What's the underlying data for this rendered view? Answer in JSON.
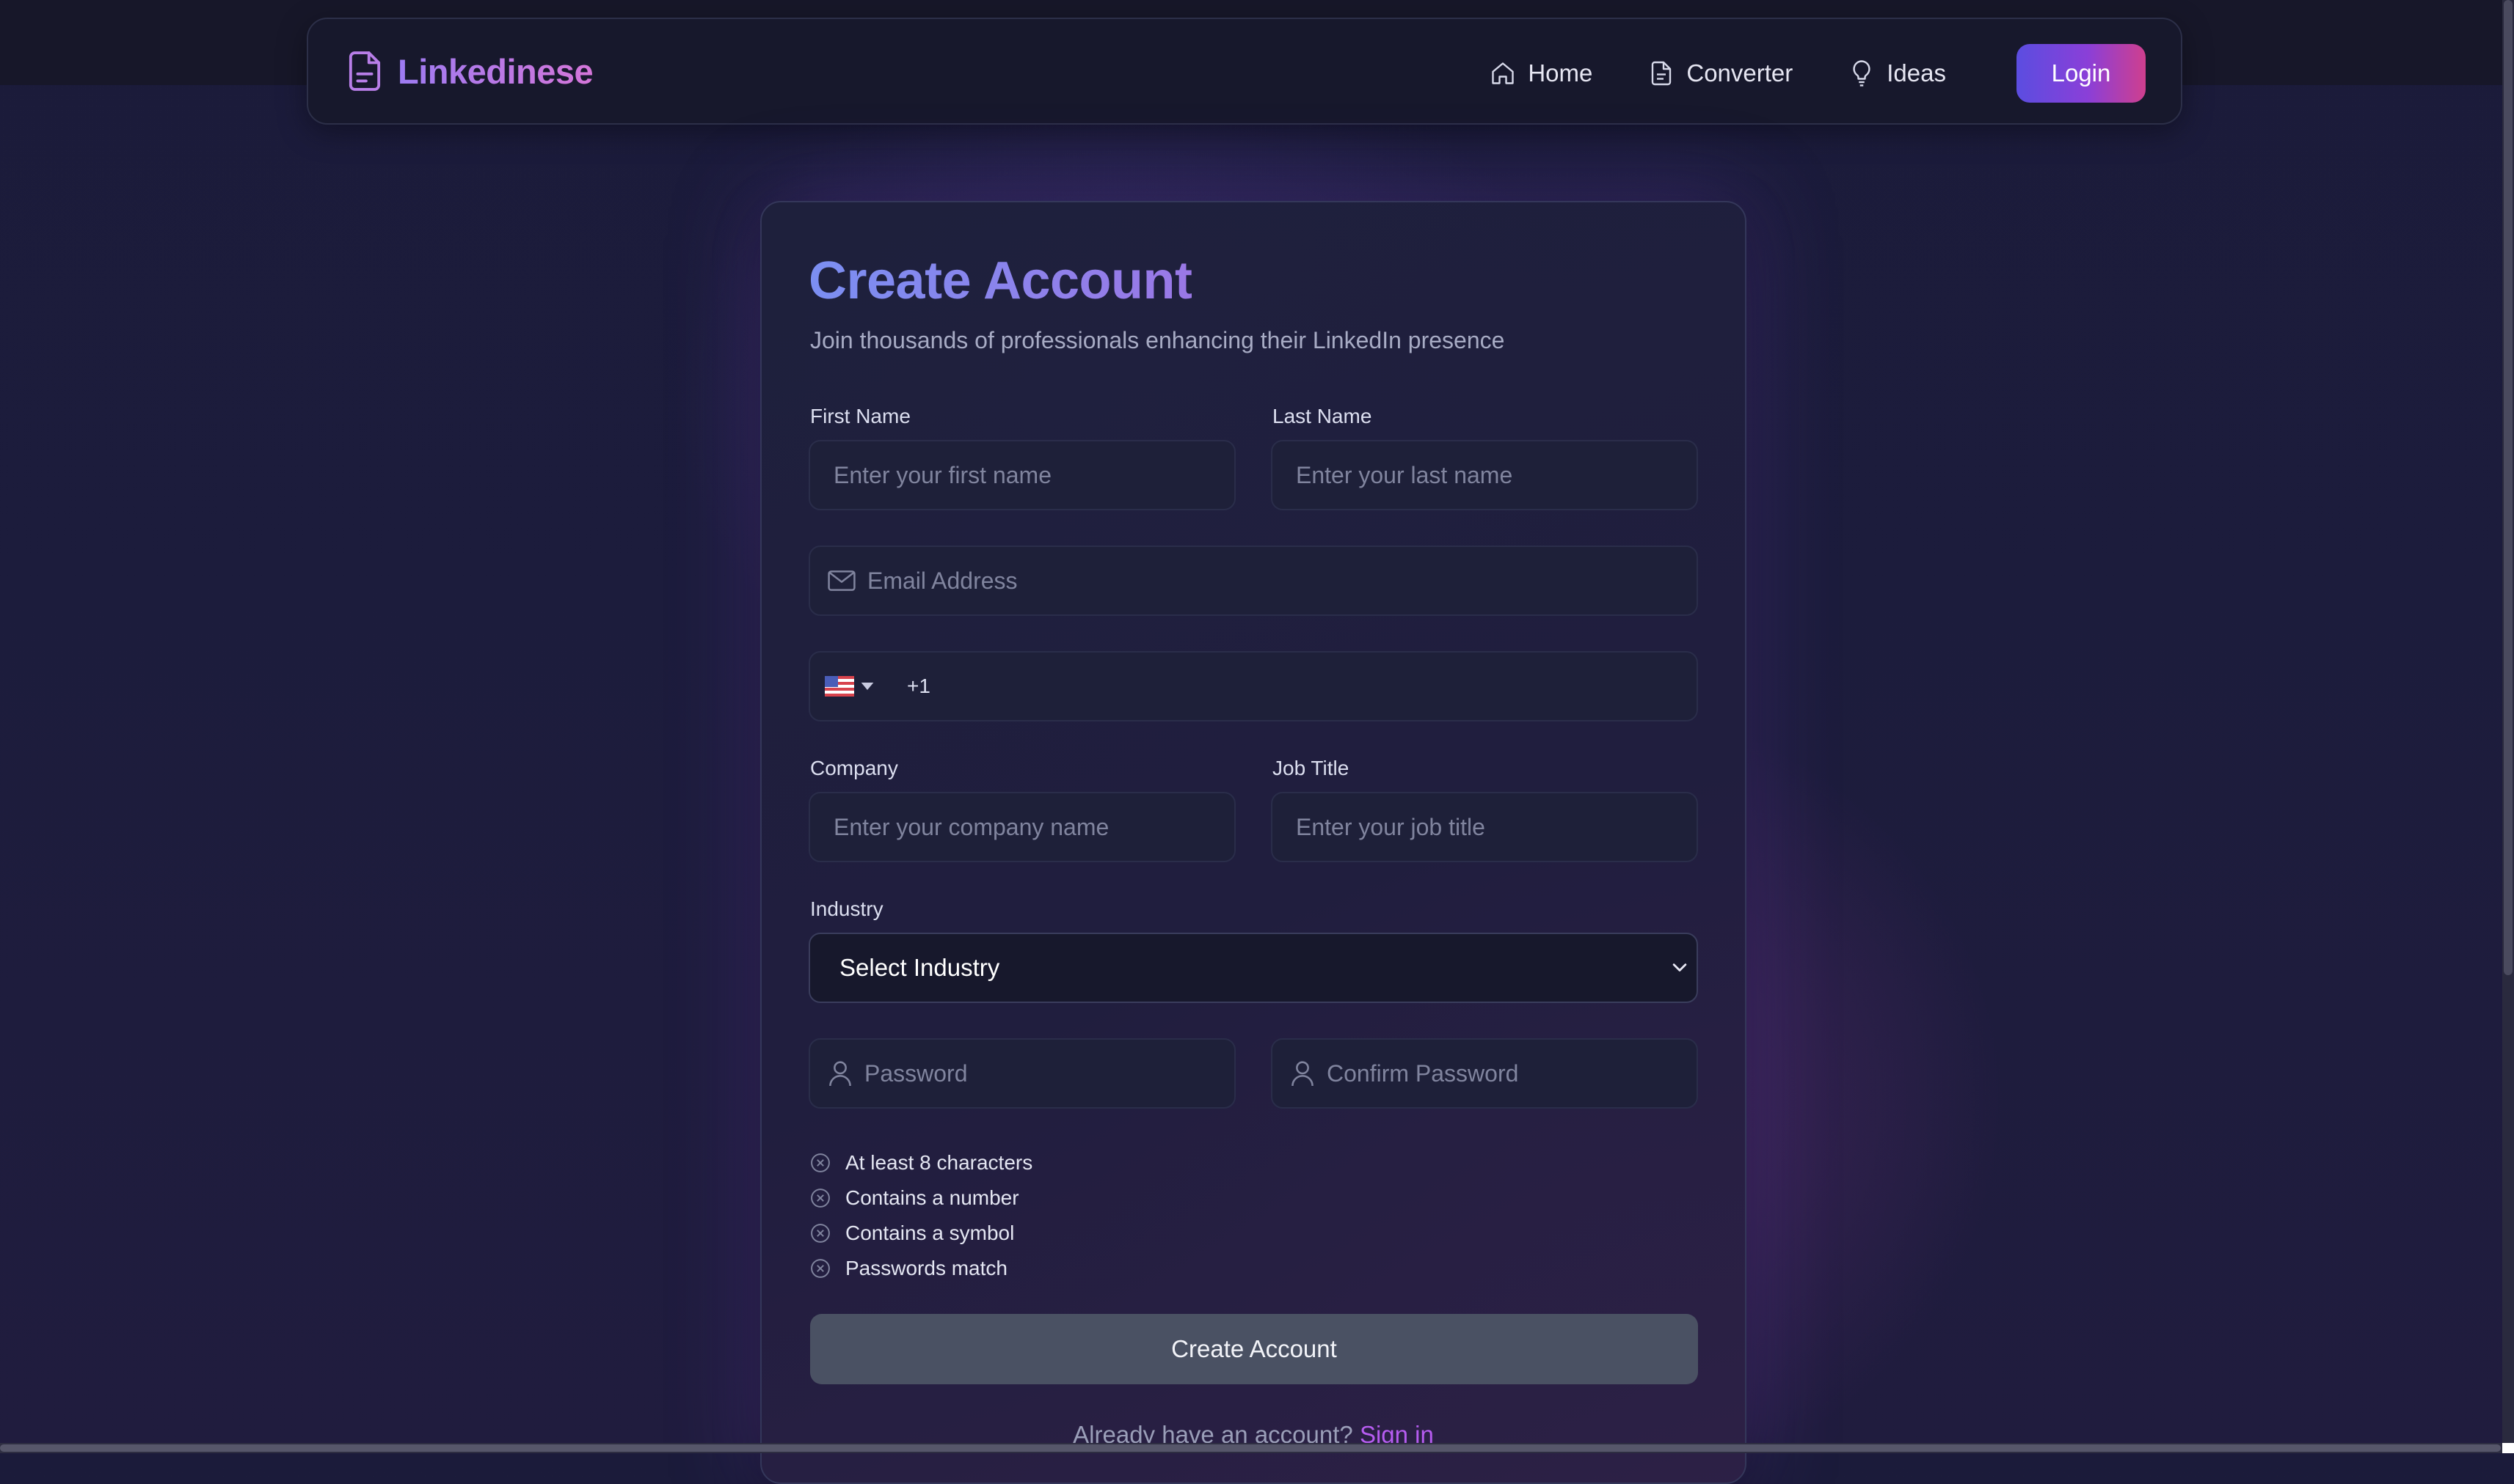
{
  "app": {
    "brand": "Linkedinese"
  },
  "nav": {
    "items": [
      {
        "label": "Home",
        "icon": "home-icon"
      },
      {
        "label": "Converter",
        "icon": "document-icon"
      },
      {
        "label": "Ideas",
        "icon": "lightbulb-icon"
      }
    ],
    "login_label": "Login"
  },
  "form": {
    "title": "Create Account",
    "subtitle": "Join thousands of professionals enhancing their LinkedIn presence",
    "first_name": {
      "label": "First Name",
      "placeholder": "Enter your first name",
      "value": ""
    },
    "last_name": {
      "label": "Last Name",
      "placeholder": "Enter your last name",
      "value": ""
    },
    "email": {
      "placeholder": "Email Address",
      "value": ""
    },
    "phone": {
      "country": "US",
      "dial_code": "+1",
      "value": ""
    },
    "company": {
      "label": "Company",
      "placeholder": "Enter your company name",
      "value": ""
    },
    "job_title": {
      "label": "Job Title",
      "placeholder": "Enter your job title",
      "value": ""
    },
    "industry": {
      "label": "Industry",
      "selected": "Select Industry"
    },
    "password": {
      "placeholder": "Password",
      "value": ""
    },
    "confirm_password": {
      "placeholder": "Confirm Password",
      "value": ""
    },
    "requirements": [
      "At least 8 characters",
      "Contains a number",
      "Contains a symbol",
      "Passwords match"
    ],
    "submit_label": "Create Account",
    "signin_prompt": "Already have an account?",
    "signin_link": "Sign in"
  },
  "colors": {
    "brand_gradient_start": "#9d7bf2",
    "brand_gradient_end": "#d576d9",
    "login_gradient_start": "#5b4de0",
    "login_gradient_end": "#cf3f8e",
    "link": "#b65cf0",
    "submit_disabled": "#4a5163"
  }
}
